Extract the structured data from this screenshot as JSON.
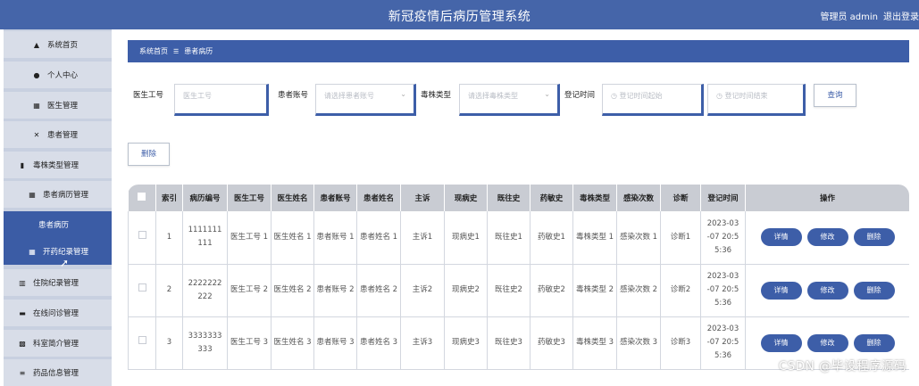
{
  "header": {
    "title": "新冠疫情后病历管理系统",
    "user": "管理员 admin",
    "logout": "退出登录"
  },
  "sidebar": {
    "items": [
      {
        "label": "系统首页",
        "icon": "home-icon",
        "glyph": "▲"
      },
      {
        "label": "个人中心",
        "icon": "user-icon",
        "glyph": "●"
      },
      {
        "label": "医生管理",
        "icon": "grid-icon",
        "glyph": "▦"
      },
      {
        "label": "患者管理",
        "icon": "crossed-icon",
        "glyph": "✕"
      },
      {
        "label": "毒株类型管理",
        "icon": "book-icon",
        "glyph": "▮"
      },
      {
        "label": "患者病历管理",
        "icon": "grid-icon",
        "glyph": "▦"
      },
      {
        "label": "患者病历",
        "icon": "",
        "glyph": ""
      },
      {
        "label": "开药纪录管理",
        "icon": "grid-icon",
        "glyph": "▦"
      },
      {
        "label": "住院纪录管理",
        "icon": "bar-chart-icon",
        "glyph": "▥"
      },
      {
        "label": "在线问诊管理",
        "icon": "briefcase-icon",
        "glyph": "▬"
      },
      {
        "label": "科室简介管理",
        "icon": "chart-box-icon",
        "glyph": "▩"
      },
      {
        "label": "药品信息管理",
        "icon": "list-icon",
        "glyph": "≡"
      }
    ]
  },
  "breadcrumb": {
    "home": "系统首页",
    "separator": "☰",
    "current": "患者病历"
  },
  "search": {
    "doctor_no_label": "医生工号",
    "doctor_no_placeholder": "医生工号",
    "patient_acct_label": "患者账号",
    "patient_acct_placeholder": "请选择患者账号",
    "strain_label": "毒株类型",
    "strain_placeholder": "请选择毒株类型",
    "time_label": "登记时间",
    "time_start_placeholder": "登记时间起始",
    "time_end_placeholder": "登记时间结束",
    "query_button": "查询"
  },
  "delete_button": "删除",
  "table": {
    "columns": [
      "索引",
      "病历编号",
      "医生工号",
      "医生姓名",
      "患者账号",
      "患者姓名",
      "主诉",
      "现病史",
      "既往史",
      "药敏史",
      "毒株类型",
      "感染次数",
      "诊断",
      "登记时间",
      "操作"
    ],
    "rows": [
      {
        "index": "1",
        "record_no": "1111111 111",
        "doctor_no": "医生工号 1",
        "doctor_name": "医生姓名 1",
        "patient_acct": "患者账号 1",
        "patient_name": "患者姓名 1",
        "complaint": "主诉1",
        "present": "现病史1",
        "past": "既往史1",
        "allergy": "药敏史1",
        "strain": "毒株类型 1",
        "infections": "感染次数 1",
        "diagnosis": "诊断1",
        "time": "2023-03 -07 20:5 5:36"
      },
      {
        "index": "2",
        "record_no": "2222222 222",
        "doctor_no": "医生工号 2",
        "doctor_name": "医生姓名 2",
        "patient_acct": "患者账号 2",
        "patient_name": "患者姓名 2",
        "complaint": "主诉2",
        "present": "现病史2",
        "past": "既往史2",
        "allergy": "药敏史2",
        "strain": "毒株类型 2",
        "infections": "感染次数 2",
        "diagnosis": "诊断2",
        "time": "2023-03 -07 20:5 5:36"
      },
      {
        "index": "3",
        "record_no": "3333333 333",
        "doctor_no": "医生工号 3",
        "doctor_name": "医生姓名 3",
        "patient_acct": "患者账号 3",
        "patient_name": "患者姓名 3",
        "complaint": "主诉3",
        "present": "现病史3",
        "past": "既往史3",
        "allergy": "药敏史3",
        "strain": "毒株类型 3",
        "infections": "感染次数 3",
        "diagnosis": "诊断3",
        "time": "2023-03 -07 20:5 5:36"
      }
    ],
    "actions": {
      "detail": "详情",
      "edit": "修改",
      "delete": "删除"
    }
  },
  "watermark": "CSDN @毕设程序源码",
  "colors": {
    "primary": "#3d5ea8",
    "header": "#4565a9",
    "sidebar": "#d8dde8",
    "table_header": "#c9ccd3"
  }
}
